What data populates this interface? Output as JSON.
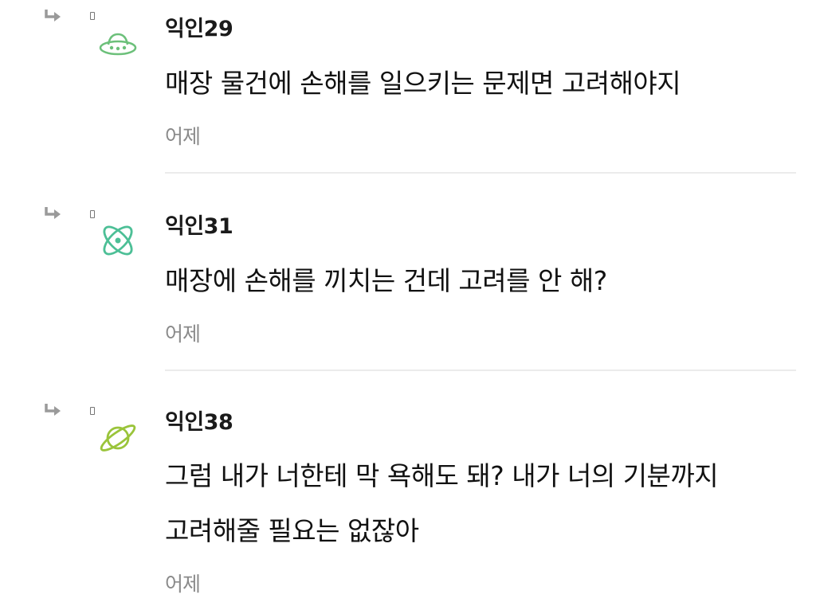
{
  "comments": [
    {
      "author": "익인29",
      "avatar_icon": "ufo-icon",
      "avatar_color": "#6cc07a",
      "lines": [
        "매장 물건에 손해를 일으키는 문제면 고려해야지"
      ],
      "time": "어제"
    },
    {
      "author": "익인31",
      "avatar_icon": "atom-icon",
      "avatar_color": "#4cbf96",
      "lines": [
        "매장에 손해를 끼치는 건데 고려를 안 해?"
      ],
      "time": "어제"
    },
    {
      "author": "익인38",
      "avatar_icon": "planet-icon",
      "avatar_color": "#9ac43a",
      "lines": [
        "그럼 내가 너한테 막 욕해도 돼? 내가 너의 기분까지",
        "고려해줄 필요는 없잖아"
      ],
      "time": "어제"
    }
  ],
  "icons": {
    "reply": "reply-arrow-icon",
    "marker": "bookmark-icon"
  }
}
